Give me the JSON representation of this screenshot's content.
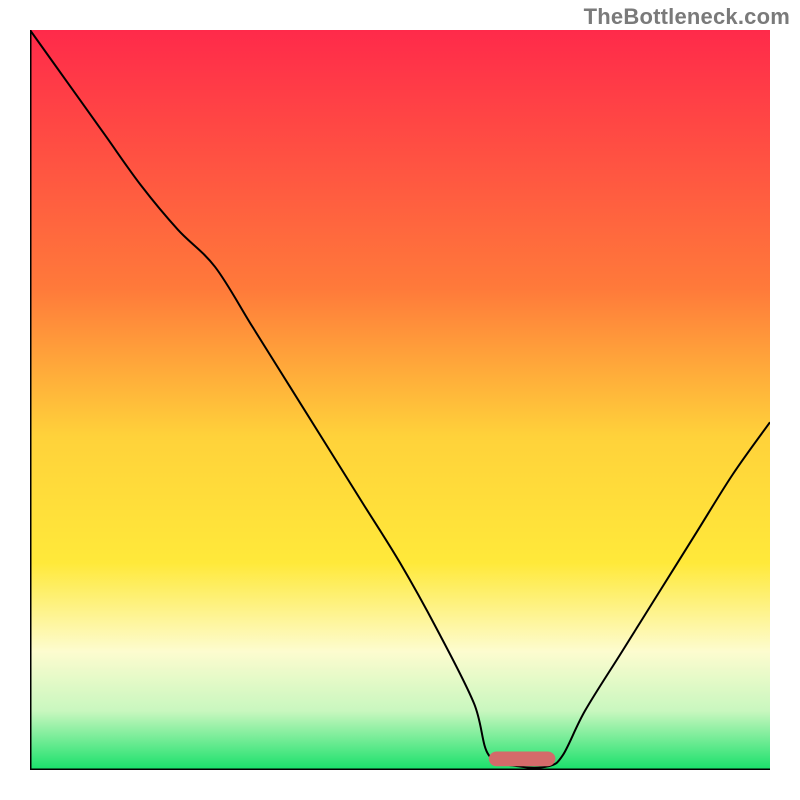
{
  "watermark": "TheBottleneck.com",
  "chart_data": {
    "type": "line",
    "title": "",
    "xlabel": "",
    "ylabel": "",
    "xlim": [
      0,
      100
    ],
    "ylim": [
      0,
      100
    ],
    "grid": false,
    "background": {
      "type": "vertical-gradient",
      "stops": [
        {
          "offset": 0.0,
          "color": "#ff2a4a"
        },
        {
          "offset": 0.35,
          "color": "#ff7a3a"
        },
        {
          "offset": 0.55,
          "color": "#ffd23a"
        },
        {
          "offset": 0.72,
          "color": "#ffe93a"
        },
        {
          "offset": 0.84,
          "color": "#fdfccf"
        },
        {
          "offset": 0.92,
          "color": "#c9f7bf"
        },
        {
          "offset": 1.0,
          "color": "#17e06a"
        }
      ]
    },
    "marker": {
      "x_pct_range": [
        62,
        71
      ],
      "y_pct": 0.5,
      "color": "#d46a6a",
      "height_pct": 2.0
    },
    "series": [
      {
        "name": "curve",
        "color": "#000000",
        "stroke_width": 2,
        "x": [
          0,
          5,
          10,
          15,
          20,
          25,
          30,
          35,
          40,
          45,
          50,
          55,
          60,
          62,
          66,
          70,
          72,
          75,
          80,
          85,
          90,
          95,
          100
        ],
        "y": [
          100,
          93,
          86,
          79,
          73,
          68,
          60,
          52,
          44,
          36,
          28,
          19,
          9,
          2,
          0.5,
          0.5,
          2,
          8,
          16,
          24,
          32,
          40,
          47
        ]
      }
    ]
  }
}
